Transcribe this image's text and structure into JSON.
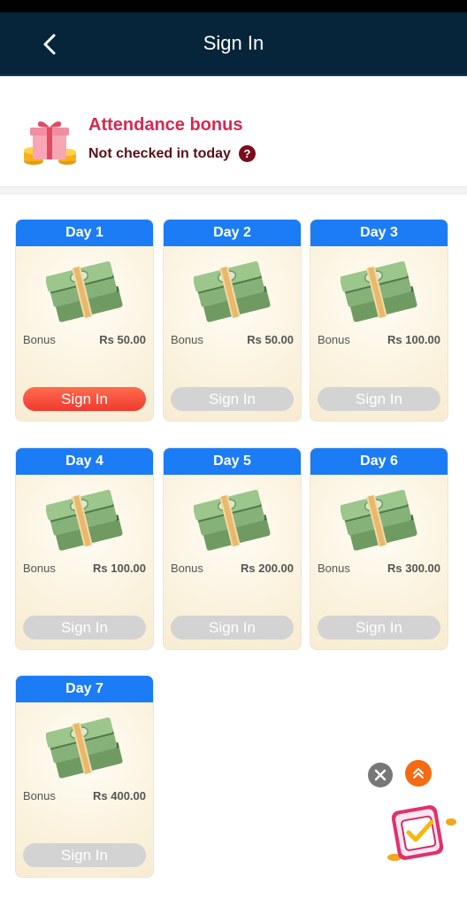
{
  "header": {
    "title": "Sign In"
  },
  "attendance": {
    "title": "Attendance bonus",
    "status": "Not checked in today",
    "help_glyph": "?"
  },
  "days": [
    {
      "label": "Day 1",
      "bonus_label": "Bonus",
      "amount": "Rs 50.00",
      "button": "Sign In",
      "active": true
    },
    {
      "label": "Day 2",
      "bonus_label": "Bonus",
      "amount": "Rs 50.00",
      "button": "Sign In",
      "active": false
    },
    {
      "label": "Day 3",
      "bonus_label": "Bonus",
      "amount": "Rs 100.00",
      "button": "Sign In",
      "active": false
    },
    {
      "label": "Day 4",
      "bonus_label": "Bonus",
      "amount": "Rs 100.00",
      "button": "Sign In",
      "active": false
    },
    {
      "label": "Day 5",
      "bonus_label": "Bonus",
      "amount": "Rs 200.00",
      "button": "Sign In",
      "active": false
    },
    {
      "label": "Day 6",
      "bonus_label": "Bonus",
      "amount": "Rs 300.00",
      "button": "Sign In",
      "active": false
    },
    {
      "label": "Day 7",
      "bonus_label": "Bonus",
      "amount": "Rs 400.00",
      "button": "Sign In",
      "active": false
    }
  ],
  "colors": {
    "header_bg": "#07253a",
    "day_header": "#1b7cf5",
    "active_button": "#ef3a2e",
    "inactive_button": "#d3d3d3",
    "attendance_title": "#d8284f"
  },
  "icons": {
    "back": "chevron-left-icon",
    "gift": "gift-coins-icon",
    "help": "question-icon",
    "money": "cash-stack-icon",
    "close": "close-icon",
    "scroll_top": "double-chevron-up-icon",
    "promo": "promo-checkbox-icon"
  }
}
